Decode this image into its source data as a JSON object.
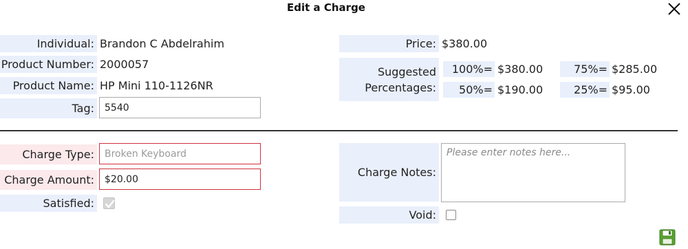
{
  "dialog": {
    "title": "Edit a Charge"
  },
  "info": {
    "individual_label": "Individual:",
    "individual_value": "Brandon C Abdelrahim",
    "product_number_label": "Product Number:",
    "product_number_value": "2000057",
    "product_name_label": "Product Name:",
    "product_name_value": "HP Mini 110-1126NR",
    "tag_label": "Tag:",
    "tag_value": "5540"
  },
  "pricing": {
    "price_label": "Price:",
    "price_value": "$380.00",
    "suggested_label_line1": "Suggested",
    "suggested_label_line2": "Percentages:",
    "percentages": [
      {
        "label": "100%=",
        "value": "$380.00"
      },
      {
        "label": "75%=",
        "value": "$285.00"
      },
      {
        "label": "50%=",
        "value": "$190.00"
      },
      {
        "label": "25%=",
        "value": "$95.00"
      }
    ]
  },
  "charge": {
    "type_label": "Charge Type:",
    "type_placeholder": "Broken Keyboard",
    "amount_label": "Charge Amount:",
    "amount_value": "$20.00",
    "satisfied_label": "Satisfied:",
    "notes_label": "Charge Notes:",
    "notes_placeholder": "Please enter notes here...",
    "void_label": "Void:"
  },
  "colors": {
    "label_bg": "#e9effb",
    "required_label_bg": "#fbe9ec",
    "error_border": "#d0303c",
    "save_green": "#5aa531"
  },
  "icons": {
    "close": "close-icon",
    "save": "save-disk-icon"
  }
}
